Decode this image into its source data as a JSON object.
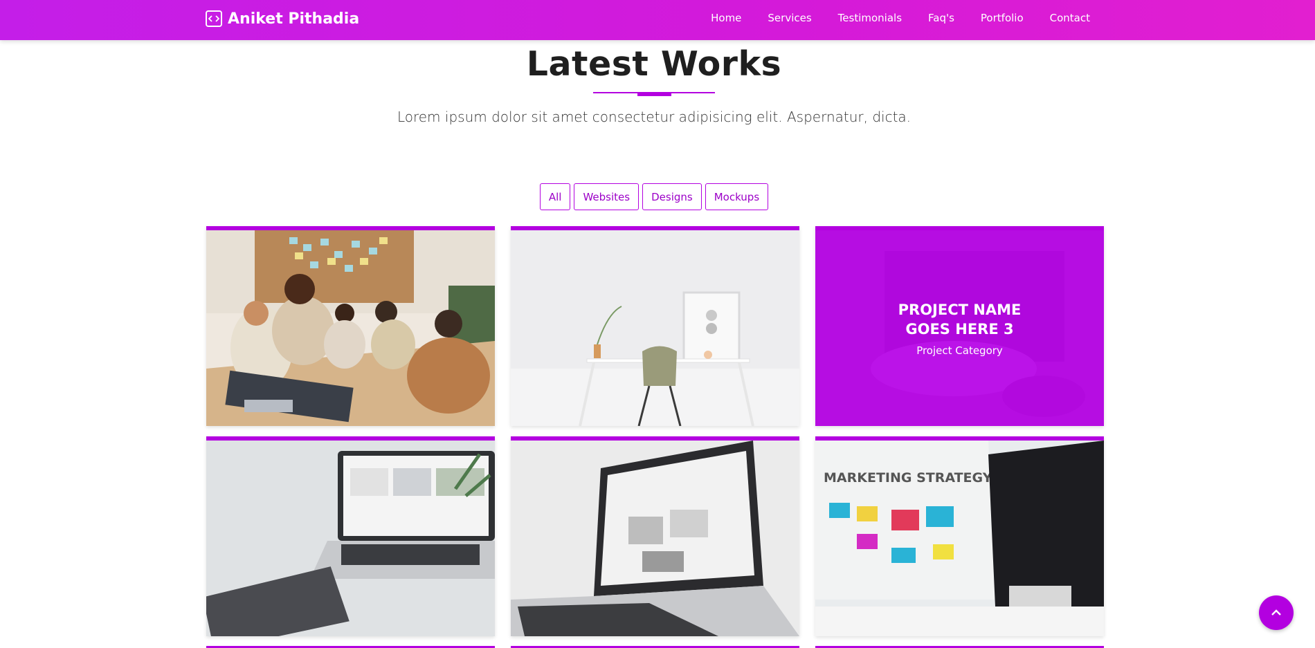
{
  "nav": {
    "brand": "Aniket Pithadia",
    "links": [
      "Home",
      "Services",
      "Testimonials",
      "Faq's",
      "Portfolio",
      "Contact"
    ]
  },
  "section": {
    "title": "Latest Works",
    "subtitle": "Lorem ipsum dolor sit amet consectetur adipisicing elit. Aspernatur, dicta."
  },
  "filters": [
    "All",
    "Websites",
    "Designs",
    "Mockups"
  ],
  "portfolio": {
    "hover_card": {
      "title": "PROJECT NAME GOES HERE 3",
      "category": "Project Category"
    }
  },
  "colors": {
    "accent": "#b300e0",
    "nav_gradient_start": "#c41ee8",
    "nav_gradient_end": "#e21fd0"
  },
  "icons": {
    "brand": "code-icon",
    "scroll_top": "chevron-up-icon"
  }
}
